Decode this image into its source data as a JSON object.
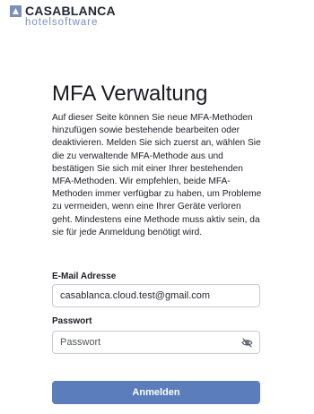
{
  "brand": {
    "name": "CASABLANCA",
    "sub": "hotelsoftware",
    "mark_color": "#7c8fb8"
  },
  "title": "MFA Verwaltung",
  "description": "Auf dieser Seite können Sie neue MFA-Methoden hinzufügen sowie bestehende bearbeiten oder deaktivieren. Melden Sie sich zuerst an, wählen Sie die zu verwaltende MFA-Methode aus und bestätigen Sie sich mit einer Ihrer bestehenden MFA-Methoden. Wir empfehlen, beide MFA-Methoden immer verfügbar zu haben, um Probleme zu vermeiden, wenn eine Ihrer Geräte verloren geht. Mindestens eine Methode muss aktiv sein, da sie für jede Anmeldung benötigt wird.",
  "form": {
    "email_label": "E-Mail Adresse",
    "email_value": "casablanca.cloud.test@gmail.com",
    "password_label": "Passwort",
    "password_placeholder": "Passwort",
    "password_toggle_icon": "eye-slash-icon",
    "submit_label": "Anmelden",
    "submit_color": "#5b7dbb"
  }
}
